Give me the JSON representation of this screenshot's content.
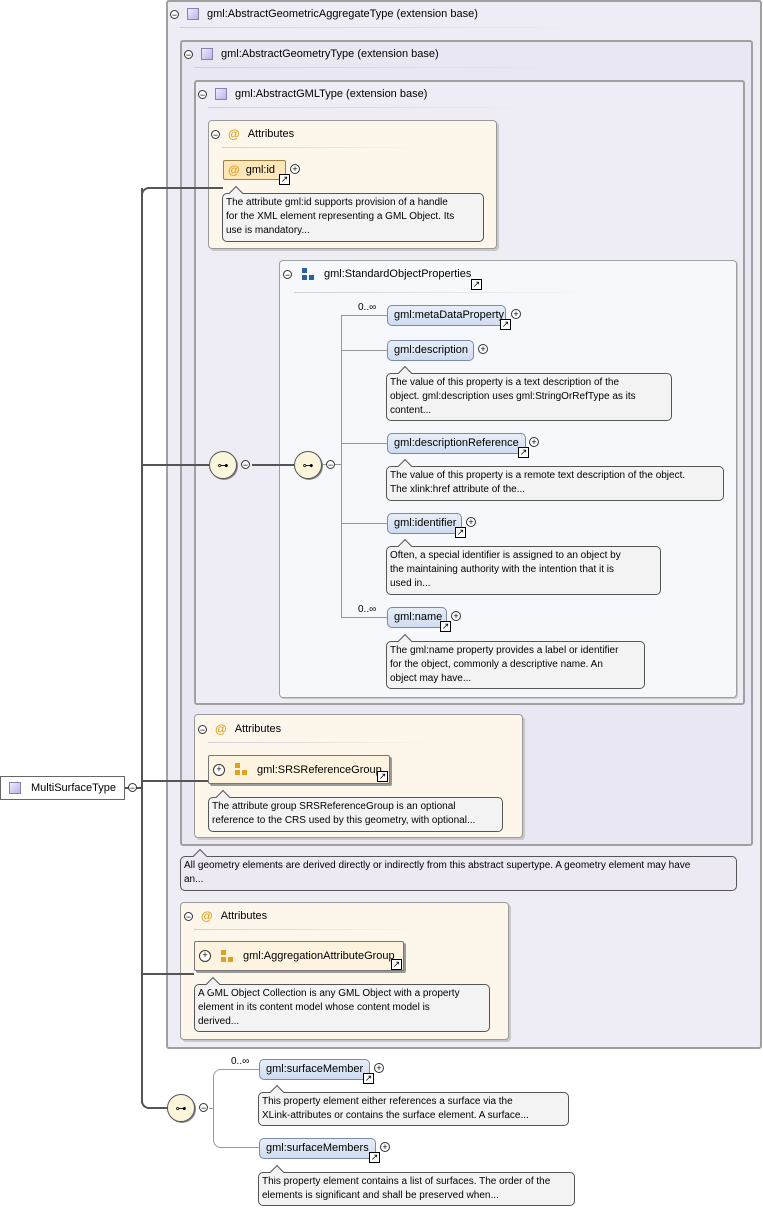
{
  "root": {
    "label": "MultiSurfaceType"
  },
  "types": {
    "aggregate": {
      "label": "gml:AbstractGeometricAggregateType (extension base)"
    },
    "geometry": {
      "label": "gml:AbstractGeometryType (extension base)"
    },
    "gml": {
      "label": "gml:AbstractGMLType (extension base)"
    }
  },
  "attr_gml": {
    "title": "Attributes",
    "id_label": "gml:id",
    "id_note": [
      "The attribute gml:id supports provision of a handle",
      "for the XML element representing a GML Object. Its",
      "use is mandatory..."
    ]
  },
  "std_props": {
    "label": "gml:StandardObjectProperties",
    "elements": [
      {
        "label": "gml:metaDataProperty",
        "cardinality": "0..∞",
        "note": []
      },
      {
        "label": "gml:description",
        "cardinality": "",
        "note": [
          "The value of this property is a text description of the",
          "object. gml:description uses gml:StringOrRefType as its",
          "content..."
        ]
      },
      {
        "label": "gml:descriptionReference",
        "cardinality": "",
        "note": [
          "The value of this property is a remote text description of the object.",
          "The xlink:href attribute of the..."
        ]
      },
      {
        "label": "gml:identifier",
        "cardinality": "",
        "note": [
          "Often, a special identifier is assigned to an object by",
          "the maintaining authority with the intention that it is",
          "used in..."
        ]
      },
      {
        "label": "gml:name",
        "cardinality": "0..∞",
        "note": [
          "The gml:name property provides a label or identifier",
          "for the object, commonly a descriptive name. An",
          "object may have..."
        ]
      }
    ]
  },
  "attr_geom": {
    "title": "Attributes",
    "group_label": "gml:SRSReferenceGroup",
    "note": [
      "The attribute group SRSReferenceGroup is an optional",
      "reference to the CRS used by this geometry, with optional..."
    ]
  },
  "geom_note": [
    "All geometry elements are derived directly or indirectly from this abstract supertype. A geometry element may have",
    "an..."
  ],
  "attr_agg": {
    "title": "Attributes",
    "group_label": "gml:AggregationAttributeGroup",
    "note": [
      "A GML Object Collection is any GML Object with a property",
      "element in its content model whose content model is",
      "derived..."
    ]
  },
  "members": [
    {
      "label": "gml:surfaceMember",
      "cardinality": "0..∞",
      "note": [
        "This property element either references a surface via the",
        "XLink-attributes or contains the surface element. A surface..."
      ]
    },
    {
      "label": "gml:surfaceMembers",
      "cardinality": "",
      "note": [
        "This property element contains a list of surfaces. The order of the",
        "elements is significant and shall be preserved when..."
      ]
    }
  ]
}
